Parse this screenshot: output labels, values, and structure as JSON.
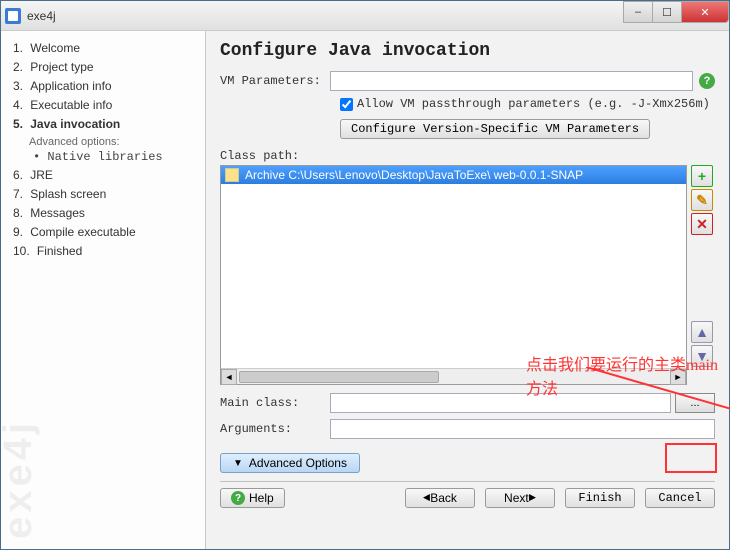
{
  "window": {
    "title": "exe4j"
  },
  "sidebar": {
    "items": [
      {
        "num": "1.",
        "label": "Welcome"
      },
      {
        "num": "2.",
        "label": "Project type"
      },
      {
        "num": "3.",
        "label": "Application info"
      },
      {
        "num": "4.",
        "label": "Executable info"
      },
      {
        "num": "5.",
        "label": "Java invocation",
        "active": true
      },
      {
        "num": "6.",
        "label": "JRE"
      },
      {
        "num": "7.",
        "label": "Splash screen"
      },
      {
        "num": "8.",
        "label": "Messages"
      },
      {
        "num": "9.",
        "label": "Compile executable"
      },
      {
        "num": "10.",
        "label": "Finished"
      }
    ],
    "advanced_head": "Advanced options:",
    "advanced_item": "• Native libraries",
    "watermark": "exe4j"
  },
  "main": {
    "heading": "Configure Java invocation",
    "vm_label": "VM Parameters:",
    "vm_value": "",
    "allow_passthrough_checked": true,
    "allow_passthrough_label": "Allow VM passthrough parameters (e.g. -J-Xmx256m)",
    "config_version_btn": "Configure Version-Specific VM Parameters",
    "classpath_label": "Class path:",
    "classpath_entry": "Archive C:\\Users\\Lenovo\\Desktop\\JavaToExe\\        web-0.0.1-SNAP",
    "main_class_label": "Main class:",
    "main_class_value": "",
    "arguments_label": "Arguments:",
    "arguments_value": "",
    "adv_options": "Advanced Options",
    "help": "Help",
    "back": "Back",
    "next": "Next",
    "finish": "Finish",
    "cancel": "Cancel"
  },
  "annotation": {
    "text": "点击我们要运行的主类main方法"
  }
}
